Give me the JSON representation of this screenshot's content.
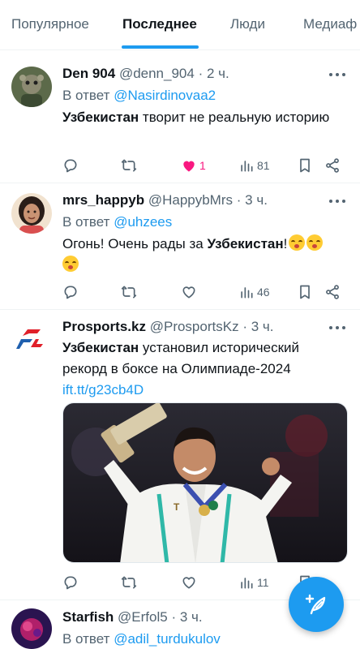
{
  "tabs": [
    {
      "label": "Популярное",
      "active": false
    },
    {
      "label": "Последнее",
      "active": true
    },
    {
      "label": "Люди",
      "active": false
    },
    {
      "label": "Медиаф",
      "active": false
    }
  ],
  "tweets": [
    {
      "name": "Den 904",
      "handle": "@denn_904",
      "time": "2 ч.",
      "reply_prefix": "В ответ",
      "reply_to": "@Nasirdinovaa2",
      "text_bold": "Узбекистан",
      "text_rest": " творит не реальную историю",
      "likes": "1",
      "views": "81",
      "liked": true
    },
    {
      "name": "mrs_happyb",
      "handle": "@HappybMrs",
      "time": "3 ч.",
      "reply_prefix": "В ответ",
      "reply_to": "@uhzees",
      "text_start": "Огонь! Очень рады за ",
      "text_bold": "Узбекистан",
      "text_end": "!",
      "views": "46",
      "liked": false
    },
    {
      "name": "Prosports.kz",
      "handle": "@ProsportsKz",
      "time": "3 ч.",
      "text_bold": "Узбекистан",
      "text_rest": " установил исторический рекорд в боксе на Олимпиаде-2024",
      "link": "ift.tt/g23cb4D",
      "views": "11",
      "liked": false
    },
    {
      "name": "Starfish",
      "handle": "@Erfol5",
      "time": "3 ч.",
      "reply_prefix": "В ответ",
      "reply_to": "@adil_turdukulov"
    }
  ],
  "colors": {
    "accent": "#1d9bf0",
    "like": "#f91880",
    "muted": "#536471",
    "text": "#0f1419"
  },
  "icons": {
    "reply": "reply-icon",
    "retweet": "retweet-icon",
    "like": "heart-icon",
    "views": "views-icon",
    "bookmark": "bookmark-icon",
    "share": "share-icon",
    "compose": "compose-icon"
  }
}
